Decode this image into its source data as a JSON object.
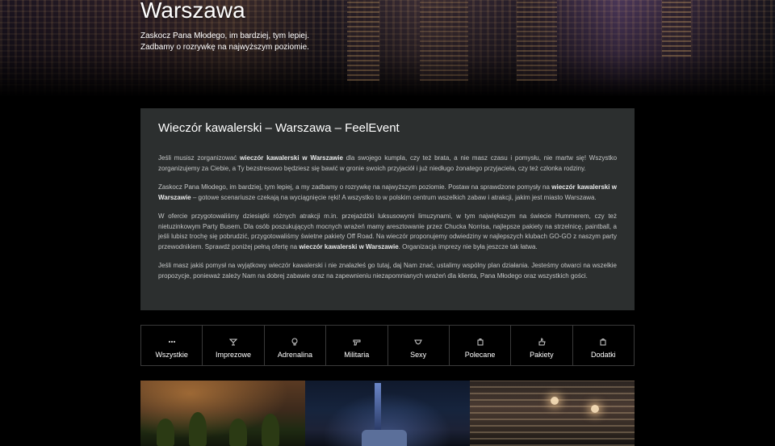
{
  "hero": {
    "title": "Warszawa",
    "subtitle_lines": [
      "Zaskocz Pana Młodego, im bardziej, tym lepiej.",
      "Zadbamy o rozrywkę na najwyższym poziomie."
    ]
  },
  "content": {
    "title": "Wieczór kawalerski – Warszawa – FeelEvent",
    "p1": {
      "t1": "Jeśli musisz zorganizować ",
      "b1": "wieczór kawalerski w Warszawie",
      "t2": " dla swojego kumpla, czy też brata, a nie masz czasu i pomysłu, nie martw się! Wszystko zorganizujemy za Ciebie, a Ty bezstresowo będziesz się bawić w gronie swoich przyjaciół i już niedługo żonatego przyjaciela, czy też członka rodziny."
    },
    "p2": {
      "t1": "Zaskocz Pana Młodego, im bardziej, tym lepiej, a my zadbamy o rozrywkę na najwyższym poziomie. Postaw na sprawdzone pomysły na ",
      "b1": "wieczór kawalerski w Warszawie",
      "t2": " – gotowe scenariusze czekają na wyciągnięcie ręki! A wszystko to w polskim centrum wszelkich zabaw i atrakcji, jakim jest miasto Warszawa."
    },
    "p3": {
      "t1": "W ofercie przygotowaliśmy dziesiątki różnych atrakcji m.in. przejażdżki luksusowymi limuzynami, w tym największym na świecie Hummerem, czy też nietuzinkowym Party Busem. Dla osób poszukujących mocnych wrażeń mamy aresztowanie przez Chucka Norrisa, najlepsze pakiety na strzelnicę, paintball, a jeśli lubisz trochę się pobrudzić, przygotowaliśmy świetne pakiety Off Road. Na wieczór proponujemy odwiedziny w najlepszych klubach GO-GO z naszym party przewodnikiem. Sprawdź poniżej pełną ofertę na ",
      "b1": "wieczór kawalerski w Warszawie",
      "t2": ". Organizacja imprezy nie była jeszcze tak łatwa."
    },
    "p4": "Jeśli masz jakiś pomysł na wyjątkowy wieczór kawalerski i nie znalazłeś go tutaj, daj Nam znać, ustalimy wspólny plan działania. Jesteśmy otwarci na wszelkie propozycje, ponieważ zależy Nam na dobrej zabawie oraz na zapewnieniu niezapomnianych wrażeń dla klienta, Pana Młodego oraz wszystkich gości."
  },
  "categories": [
    {
      "label": "Wszystkie",
      "icon": "dots-icon"
    },
    {
      "label": "Imprezowe",
      "icon": "cocktail-icon"
    },
    {
      "label": "Adrenalina",
      "icon": "bulb-icon"
    },
    {
      "label": "Militaria",
      "icon": "gun-icon"
    },
    {
      "label": "Sexy",
      "icon": "lingerie-icon"
    },
    {
      "label": "Polecane",
      "icon": "bag-icon"
    },
    {
      "label": "Pakiety",
      "icon": "thumb-icon"
    },
    {
      "label": "Dodatki",
      "icon": "shopping-bag-icon"
    }
  ]
}
